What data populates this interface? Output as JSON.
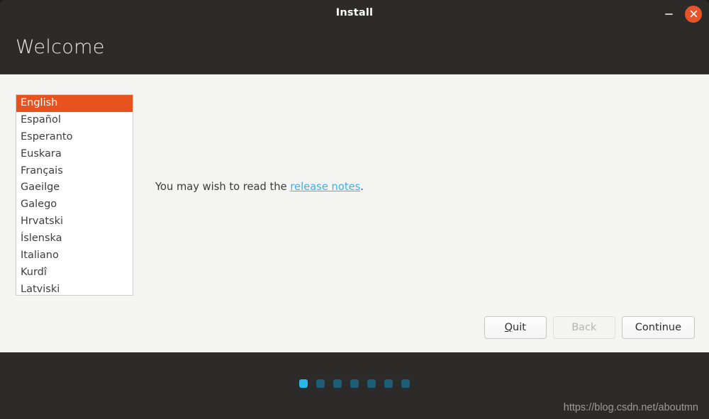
{
  "window": {
    "title": "Install",
    "controls": {
      "minimize_icon": "minimize-icon",
      "close_icon": "close-icon"
    }
  },
  "header": {
    "heading": "Welcome"
  },
  "language_list": {
    "selected": "English",
    "items": [
      "English",
      "Español",
      "Esperanto",
      "Euskara",
      "Français",
      "Gaeilge",
      "Galego",
      "Hrvatski",
      "Íslenska",
      "Italiano",
      "Kurdî",
      "Latviski"
    ]
  },
  "main": {
    "release_text_before": "You may wish to read the ",
    "release_link": "release notes",
    "release_text_after": "."
  },
  "buttons": {
    "quit": {
      "mnemonic": "Q",
      "rest": "uit"
    },
    "back": "Back",
    "continue": "Continue"
  },
  "footer": {
    "dots": [
      {
        "active": true
      },
      {
        "active": false
      },
      {
        "active": false
      },
      {
        "active": false
      },
      {
        "active": false
      },
      {
        "active": false
      },
      {
        "active": false
      }
    ],
    "watermark": "https://blog.csdn.net/aboutmn"
  },
  "colors": {
    "titlebar_bg": "#2c2b2a",
    "content_bg": "#f4f4f3",
    "accent_orange": "#e8521f",
    "close_orange": "#e8542a",
    "link_blue": "#3db0e8",
    "dot_active": "#29b6e8",
    "dot_inactive": "#1f5c77"
  }
}
